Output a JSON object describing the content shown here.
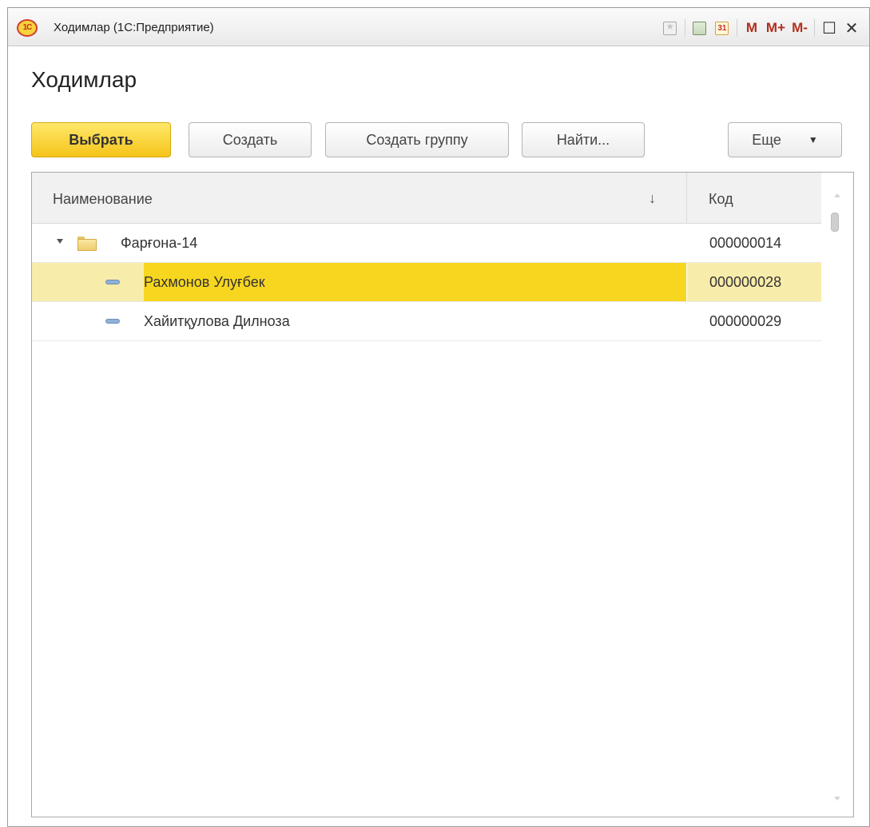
{
  "window": {
    "title": "Ходимлар (1С:Предприятие)",
    "logo_text": "1С",
    "toolbar": {
      "calendar_day": "31",
      "m_label": "M",
      "m_plus_label": "M+",
      "m_minus_label": "M-",
      "maximize_glyph": "☐",
      "close_glyph": "✕"
    }
  },
  "form": {
    "title": "Ходимлар"
  },
  "commands": {
    "select_label": "Выбрать",
    "create_label": "Создать",
    "create_group_label": "Создать группу",
    "find_label": "Найти...",
    "more_label": "Еще",
    "more_caret": "▼"
  },
  "table": {
    "columns": {
      "name": "Наименование",
      "sort_indicator": "↓",
      "code": "Код"
    },
    "rows": [
      {
        "type": "group",
        "name": "Фарғона-14",
        "code": "000000014",
        "selected": false
      },
      {
        "type": "item",
        "name": "Рахмонов Улуғбек",
        "code": "000000028",
        "selected": true
      },
      {
        "type": "item",
        "name": "Хайитқулова Дилноза",
        "code": "000000029",
        "selected": false
      }
    ]
  },
  "colors": {
    "primary_button": "#f5c419",
    "selection_row": "#f8ecaa",
    "selection_cell": "#f7d620"
  }
}
